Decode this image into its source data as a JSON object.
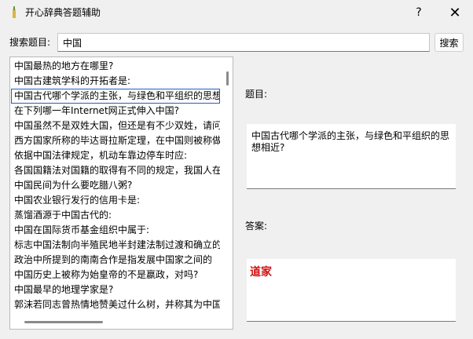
{
  "window": {
    "title": "开心辞典答题辅助",
    "help_label": "?",
    "close_label": "✕"
  },
  "search": {
    "label": "搜索题目:",
    "value": "中国",
    "button_label": "搜索"
  },
  "results": {
    "selected_index": 2,
    "items": [
      "中国最热的地方在哪里?",
      "中国古建筑学科的开拓者是:",
      "中国古代哪个学派的主张，与绿色和平组织的思想",
      "在下列哪一年Internet网正式伸入中国?",
      "中国虽然不是双姓大国，但还是有不少双姓，请问",
      "西方国家所称的毕达哥拉斯定理，在中国则被称做",
      "依据中国法律规定，机动车靠边停车时应:",
      "各国国籍法对国籍的取得有不同的规定，我国人在",
      "中国民间为什么要吃腊八粥?",
      "中国农业银行发行的信用卡是:",
      "蒸馏酒源于中国古代的:",
      "中国在国际货币基金组织中属于:",
      "标志中国法制向半殖民地半封建法制过渡和确立的",
      "政治中所提到的南南合作是指发展中国家之间的",
      "中国历史上被称为始皇帝的不是嬴政，对吗?",
      "中国最早的地理学家是?",
      "郭沫若同志曾热情地赞美过什么树，并称其为中国"
    ]
  },
  "question": {
    "label": "题目:",
    "text": "中国古代哪个学派的主张，与绿色和平组织的思想相近?"
  },
  "answer": {
    "label": "答案:",
    "text": "道家"
  },
  "colors": {
    "window_bg": "#f0f0f0",
    "answer_text": "#cc1111",
    "selection_border": "#1f5fbf"
  }
}
